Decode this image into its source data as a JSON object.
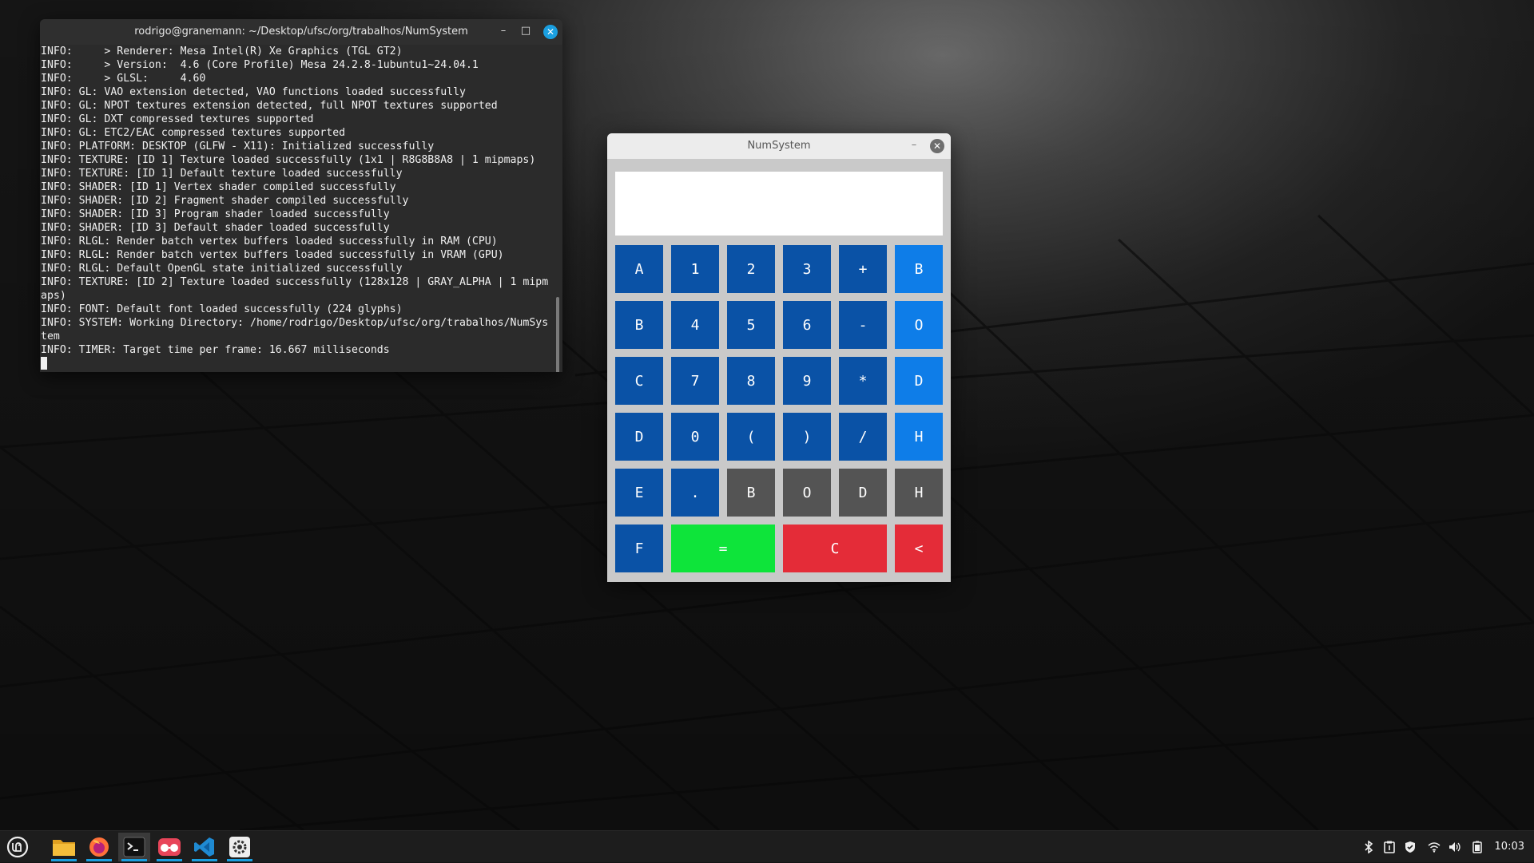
{
  "terminal": {
    "title": "rodrigo@granemann: ~/Desktop/ufsc/org/trabalhos/NumSystem",
    "lines": [
      "INFO:     > Renderer: Mesa Intel(R) Xe Graphics (TGL GT2)",
      "INFO:     > Version:  4.6 (Core Profile) Mesa 24.2.8-1ubuntu1~24.04.1",
      "INFO:     > GLSL:     4.60",
      "INFO: GL: VAO extension detected, VAO functions loaded successfully",
      "INFO: GL: NPOT textures extension detected, full NPOT textures supported",
      "INFO: GL: DXT compressed textures supported",
      "INFO: GL: ETC2/EAC compressed textures supported",
      "INFO: PLATFORM: DESKTOP (GLFW - X11): Initialized successfully",
      "INFO: TEXTURE: [ID 1] Texture loaded successfully (1x1 | R8G8B8A8 | 1 mipmaps)",
      "INFO: TEXTURE: [ID 1] Default texture loaded successfully",
      "INFO: SHADER: [ID 1] Vertex shader compiled successfully",
      "INFO: SHADER: [ID 2] Fragment shader compiled successfully",
      "INFO: SHADER: [ID 3] Program shader loaded successfully",
      "INFO: SHADER: [ID 3] Default shader loaded successfully",
      "INFO: RLGL: Render batch vertex buffers loaded successfully in RAM (CPU)",
      "INFO: RLGL: Render batch vertex buffers loaded successfully in VRAM (GPU)",
      "INFO: RLGL: Default OpenGL state initialized successfully",
      "INFO: TEXTURE: [ID 2] Texture loaded successfully (128x128 | GRAY_ALPHA | 1 mipm",
      "aps)",
      "INFO: FONT: Default font loaded successfully (224 glyphs)",
      "INFO: SYSTEM: Working Directory: /home/rodrigo/Desktop/ufsc/org/trabalhos/NumSys",
      "tem",
      "INFO: TIMER: Target time per frame: 16.667 milliseconds"
    ],
    "minimize": "–",
    "maximize": "□",
    "close": "✕"
  },
  "numsystem": {
    "title": "NumSystem",
    "minimize": "–",
    "close": "✕",
    "display": "",
    "rows": [
      [
        {
          "label": "A",
          "style": "dark"
        },
        {
          "label": "1",
          "style": "dark"
        },
        {
          "label": "2",
          "style": "dark"
        },
        {
          "label": "3",
          "style": "dark"
        },
        {
          "label": "+",
          "style": "dark"
        },
        {
          "label": "B",
          "style": "light"
        }
      ],
      [
        {
          "label": "B",
          "style": "dark"
        },
        {
          "label": "4",
          "style": "dark"
        },
        {
          "label": "5",
          "style": "dark"
        },
        {
          "label": "6",
          "style": "dark"
        },
        {
          "label": "-",
          "style": "dark"
        },
        {
          "label": "O",
          "style": "light"
        }
      ],
      [
        {
          "label": "C",
          "style": "dark"
        },
        {
          "label": "7",
          "style": "dark"
        },
        {
          "label": "8",
          "style": "dark"
        },
        {
          "label": "9",
          "style": "dark"
        },
        {
          "label": "*",
          "style": "dark"
        },
        {
          "label": "D",
          "style": "light"
        }
      ],
      [
        {
          "label": "D",
          "style": "dark"
        },
        {
          "label": "0",
          "style": "dark"
        },
        {
          "label": "(",
          "style": "dark"
        },
        {
          "label": ")",
          "style": "dark"
        },
        {
          "label": "/",
          "style": "dark"
        },
        {
          "label": "H",
          "style": "light"
        }
      ],
      [
        {
          "label": "E",
          "style": "dark"
        },
        {
          "label": ".",
          "style": "dark"
        },
        {
          "label": "B",
          "style": "gray"
        },
        {
          "label": "O",
          "style": "gray"
        },
        {
          "label": "D",
          "style": "gray"
        },
        {
          "label": "H",
          "style": "gray"
        }
      ],
      [
        {
          "label": "F",
          "style": "dark"
        },
        {
          "label": "=",
          "style": "green",
          "span": 2
        },
        {
          "label": "C",
          "style": "red",
          "span": 2
        },
        {
          "label": "<",
          "style": "red"
        }
      ]
    ],
    "colors": {
      "dark": "#0a52a6",
      "light": "#0e7de8",
      "gray": "#545454",
      "green": "#0ee43a",
      "red": "#e42c38"
    }
  },
  "taskbar": {
    "apps": [
      {
        "name": "mint-menu-icon"
      },
      {
        "name": "files-icon"
      },
      {
        "name": "firefox-icon"
      },
      {
        "name": "terminal-icon",
        "active": true
      },
      {
        "name": "glasses-app-icon"
      },
      {
        "name": "vscode-icon"
      },
      {
        "name": "settings-icon"
      }
    ],
    "tray": [
      "bluetooth-icon",
      "clipboard-icon",
      "shield-icon",
      "wifi-icon",
      "volume-icon",
      "battery-icon"
    ],
    "clock": "10:03"
  }
}
